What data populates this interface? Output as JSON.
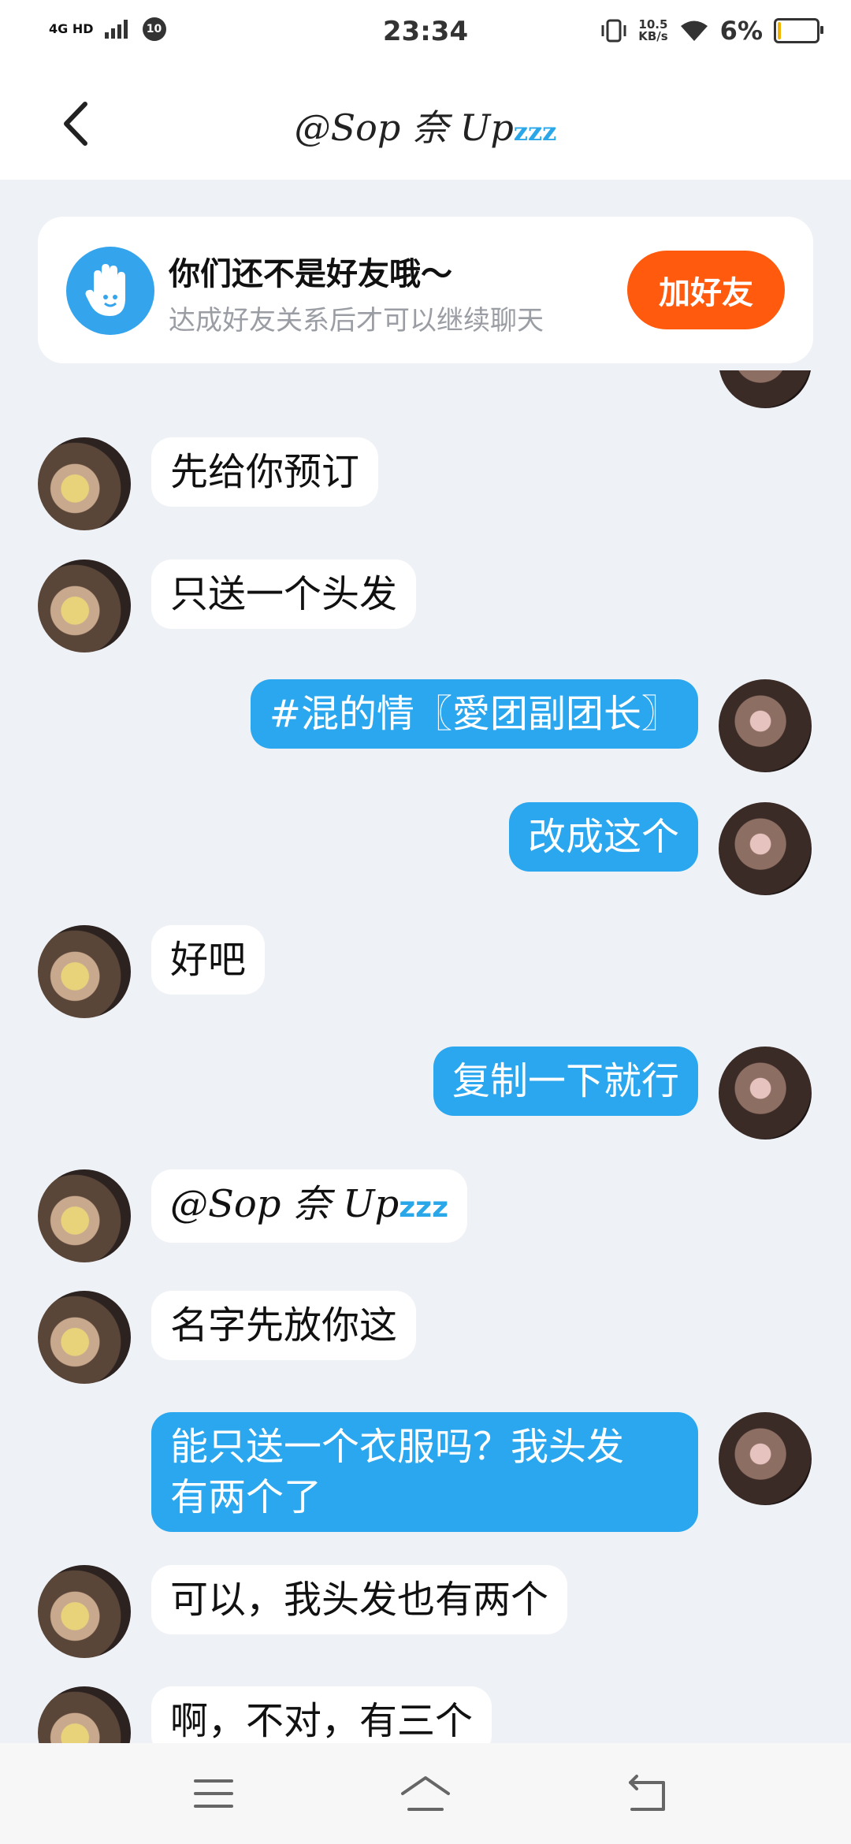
{
  "status_bar": {
    "network": "4G HD",
    "badge": "10",
    "time": "23:34",
    "speed_top": "10.5",
    "speed_unit": "KB/s",
    "battery": "6%",
    "battery_level": 0.06,
    "battery_color": "#f2b300"
  },
  "header": {
    "title_prefix": "@Sop 奈 Up",
    "title_suffix": "zzz",
    "back_icon": "chevron-left-icon"
  },
  "friend_card": {
    "title": "你们还不是好友哦～",
    "subtitle": "达成好友关系后才可以继续聊天",
    "button": "加好友",
    "button_color": "#ff5a0e",
    "icon": "hand-wave-icon"
  },
  "messages": [
    {
      "side": "in",
      "text": "先给你预订"
    },
    {
      "side": "in",
      "text": "只送一个头发"
    },
    {
      "side": "out",
      "text": "#混的情〖愛团副团长〗"
    },
    {
      "side": "out",
      "text": "改成这个"
    },
    {
      "side": "in",
      "text": "好吧"
    },
    {
      "side": "out",
      "text": "复制一下就行"
    },
    {
      "side": "in",
      "text_prefix": "@Sop 奈 Up",
      "text_suffix": "zzz"
    },
    {
      "side": "in",
      "text": "名字先放你这"
    },
    {
      "side": "out",
      "line1": "能只送一个衣服吗？我头发",
      "line2": "有两个了"
    },
    {
      "side": "in",
      "text": "可以，我头发也有两个"
    },
    {
      "side": "in",
      "text": "啊，不对，有三个"
    }
  ],
  "nav": [
    "menu-icon",
    "home-icon",
    "back-icon"
  ],
  "colors": {
    "accent_blue": "#2aa7ee",
    "background": "#eef1f5"
  }
}
